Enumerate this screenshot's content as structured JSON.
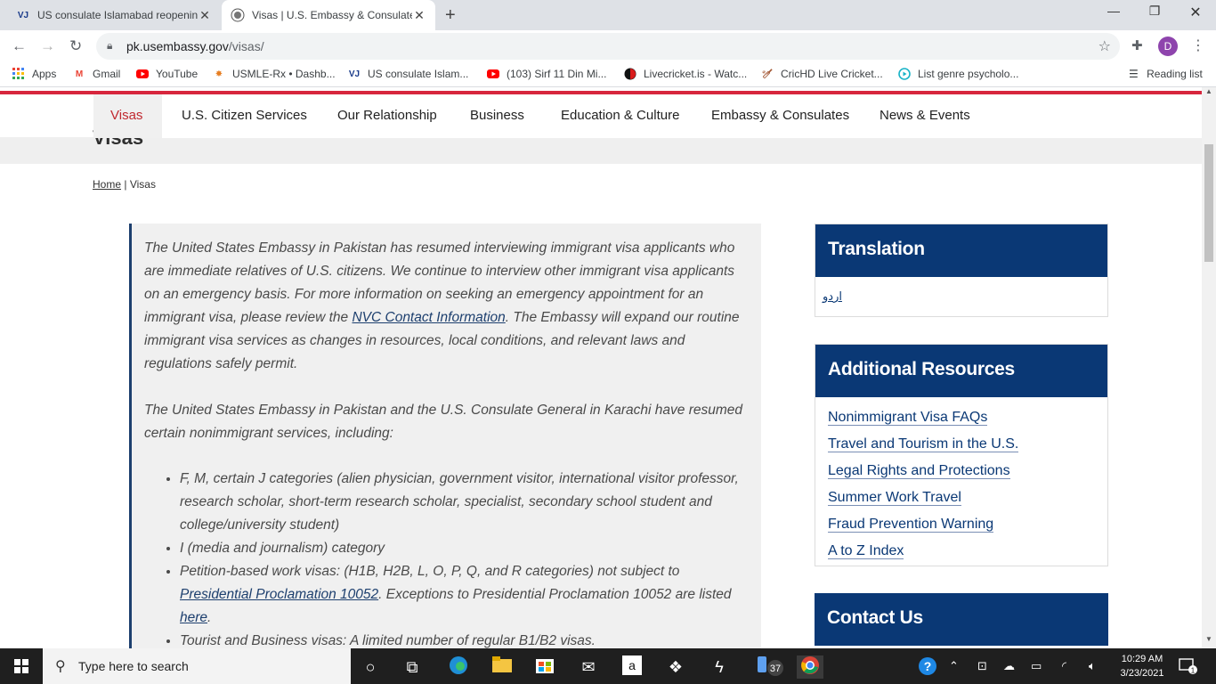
{
  "browser": {
    "tabs": [
      {
        "favicon": "VJ",
        "title": "US consulate Islamabad reopenin",
        "active": false
      },
      {
        "favicon": "seal",
        "title": "Visas | U.S. Embassy & Consulate",
        "active": true
      }
    ],
    "new_tab": "+",
    "url_domain": "pk.usembassy.gov",
    "url_path": "/visas/",
    "avatar_letter": "D",
    "bookmarks": [
      {
        "icon": "apps-grid-icon",
        "label": "Apps"
      },
      {
        "icon": "gmail-icon",
        "label": "Gmail"
      },
      {
        "icon": "youtube-icon",
        "label": "YouTube"
      },
      {
        "icon": "usmle-icon",
        "label": "USMLE-Rx • Dashb..."
      },
      {
        "icon": "vj-icon",
        "label": "US consulate Islam..."
      },
      {
        "icon": "youtube-icon",
        "label": "(103) Sirf 11 Din Mi..."
      },
      {
        "icon": "livecricket-icon",
        "label": "Livecricket.is - Watc..."
      },
      {
        "icon": "crichd-icon",
        "label": "CricHD Live Cricket..."
      },
      {
        "icon": "play-icon",
        "label": "List genre psycholo..."
      }
    ],
    "reading_list": "Reading list"
  },
  "site": {
    "nav": [
      "Visas",
      "U.S. Citizen Services",
      "Our Relationship",
      "Business",
      "Education & Culture",
      "Embassy & Consulates",
      "News & Events"
    ],
    "page_title": "Visas",
    "breadcrumb_home": "Home",
    "breadcrumb_sep": " | ",
    "breadcrumb_current": "Visas",
    "alert": {
      "p1_a": "The United States Embassy in Pakistan has resumed interviewing immigrant visa applicants who are immediate relatives of U.S. citizens.  We continue to interview other immigrant visa applicants on an emergency basis.  For more information on seeking an emergency appointment for an immigrant visa, please review the ",
      "p1_link": "NVC Contact Information",
      "p1_b": ".  The Embassy will expand our routine immigrant visa services as changes in resources, local conditions, and relevant laws and regulations safely permit.",
      "p2": "The United States Embassy in Pakistan and the U.S. Consulate General in Karachi have resumed certain nonimmigrant services, including:",
      "li1": "F, M, certain J categories (alien physician, government visitor, international visitor professor, research scholar, short-term research scholar, specialist, secondary school student and college/university student)",
      "li2": "I (media and journalism) category",
      "li3_a": "Petition-based work visas: (H1B, H2B, L, O, P, Q, and R categories) not subject to ",
      "li3_link": "Presidential Proclamation 10052",
      "li3_b": ".  Exceptions to Presidential Proclamation 10052 are listed ",
      "li3_link2": "here",
      "li3_c": ".",
      "li4": "Tourist and Business visas: A limited number of regular B1/B2 visas."
    },
    "translation": {
      "title": "Translation",
      "link": "اردو"
    },
    "resources": {
      "title": "Additional Resources",
      "links": [
        "Nonimmigrant Visa FAQs",
        "Travel and Tourism in the U.S.",
        "Legal Rights and Protections",
        "Summer Work Travel",
        "Fraud Prevention Warning",
        "A to Z Index"
      ]
    },
    "contact": {
      "title": "Contact Us"
    }
  },
  "taskbar": {
    "search_placeholder": "Type here to search",
    "badge_count": "37",
    "time": "10:29 AM",
    "date": "3/23/2021",
    "notification_count": "1"
  },
  "colors": {
    "accent_red": "#c0282f",
    "navy": "#0a3875"
  }
}
